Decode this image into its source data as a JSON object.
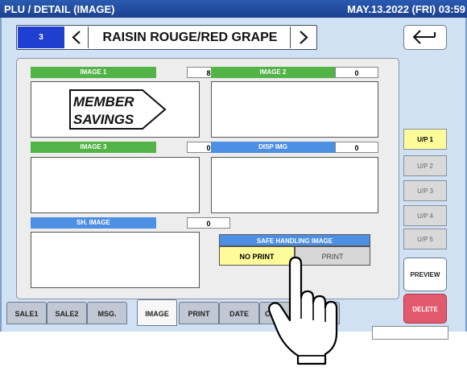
{
  "titlebar": {
    "title": "PLU / DETAIL (IMAGE)",
    "datetime": "MAY.13.2022 (FRI) 03:59"
  },
  "plu": {
    "number": "3",
    "name": "RAISIN ROUGE/RED GRAPE"
  },
  "slots": {
    "image1": {
      "label": "IMAGE 1",
      "value": "8",
      "image_text_line1": "MEMBER",
      "image_text_line2": "SAVINGS"
    },
    "image2": {
      "label": "IMAGE 2",
      "value": "0"
    },
    "image3": {
      "label": "IMAGE 3",
      "value": "0"
    },
    "disp_img": {
      "label": "DISP IMG",
      "value": "0"
    },
    "sh_image": {
      "label": "SH. IMAGE",
      "value": "0"
    }
  },
  "safe_handling": {
    "title": "SAFE HANDLING IMAGE",
    "no_print": "NO PRINT",
    "print": "PRINT",
    "selected": "NO PRINT"
  },
  "tabs": [
    "SALE1",
    "SALE2",
    "MSG.",
    "IMAGE",
    "PRINT",
    "DATE",
    "CO"
  ],
  "active_tab": "IMAGE",
  "up_buttons": [
    "U/P 1",
    "U/P 2",
    "U/P 3",
    "U/P 4",
    "U/P 5"
  ],
  "selected_up": "U/P 1",
  "actions": {
    "preview": "PREVIEW",
    "delete": "DELETE"
  },
  "colors": {
    "titlebar": "#1c418d",
    "green_header": "#52b447",
    "blue_header": "#4d8fe2",
    "selected": "#fefc9a",
    "delete": "#e35a6e",
    "plu_number": "#1f3fd0"
  }
}
